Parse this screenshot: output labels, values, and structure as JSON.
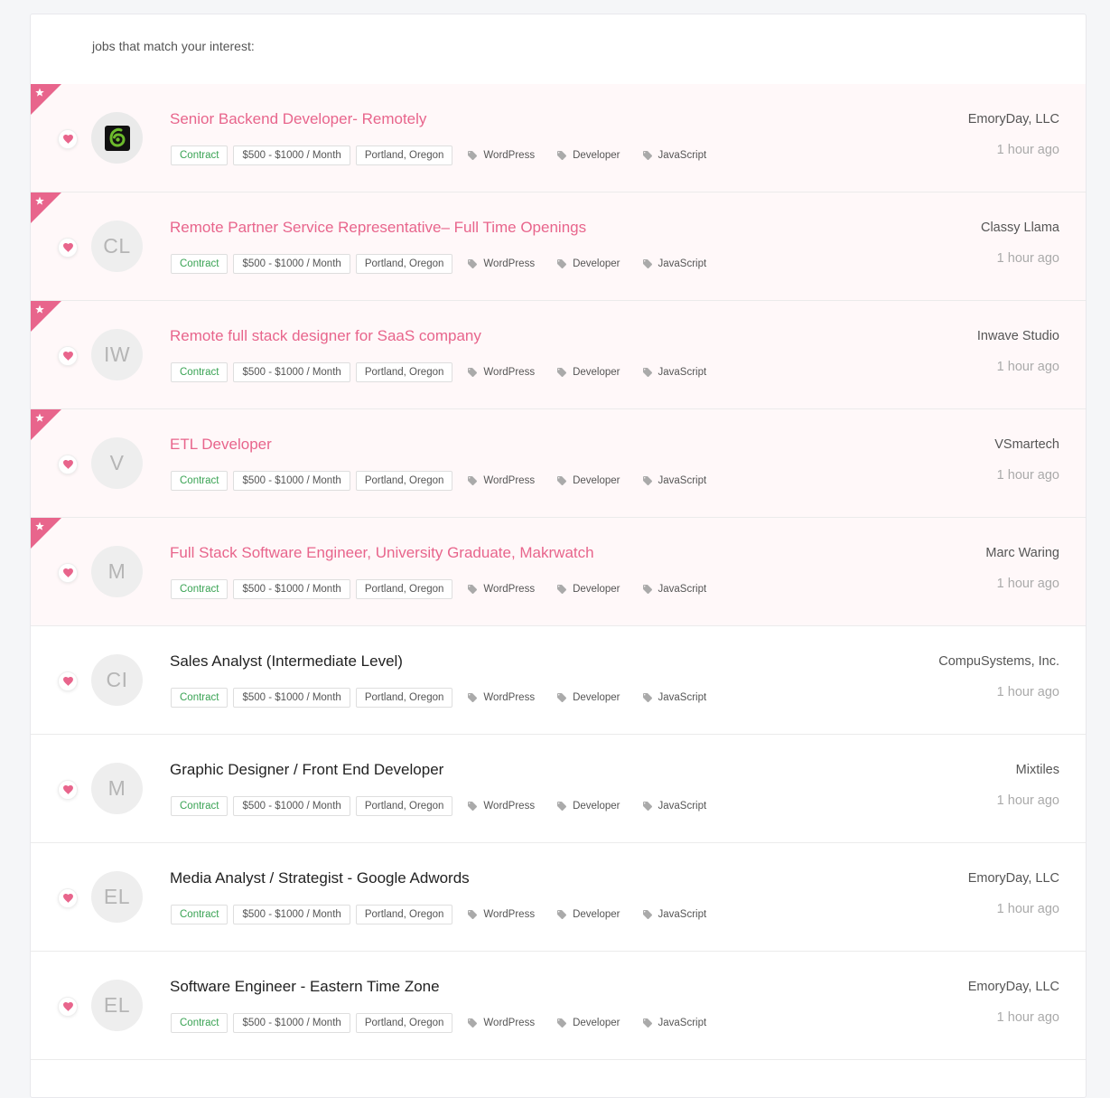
{
  "heading": "jobs that match your interest:",
  "colors": {
    "accent": "#e8658c",
    "contract": "#3aa354",
    "logo_green": "#6dbb2c"
  },
  "jobs": [
    {
      "title": "Senior Backend Developer- Remotely",
      "company": "EmoryDay, LLC",
      "time": "1 hour ago",
      "featured": true,
      "avatar": "",
      "logo": "green-swirl-logo",
      "type": "Contract",
      "salary": "$500 - $1000 / Month",
      "location": "Portland, Oregon",
      "skills": [
        "WordPress",
        "Developer",
        "JavaScript"
      ]
    },
    {
      "title": "Remote Partner Service Representative– Full Time Openings",
      "company": "Classy Llama",
      "time": "1 hour ago",
      "featured": true,
      "avatar": "CL",
      "type": "Contract",
      "salary": "$500 - $1000 / Month",
      "location": "Portland, Oregon",
      "skills": [
        "WordPress",
        "Developer",
        "JavaScript"
      ]
    },
    {
      "title": "Remote full stack designer for SaaS company",
      "company": "Inwave Studio",
      "time": "1 hour ago",
      "featured": true,
      "avatar": "IW",
      "type": "Contract",
      "salary": "$500 - $1000 / Month",
      "location": "Portland, Oregon",
      "skills": [
        "WordPress",
        "Developer",
        "JavaScript"
      ]
    },
    {
      "title": "ETL Developer",
      "company": "VSmartech",
      "time": "1 hour ago",
      "featured": true,
      "avatar": "V",
      "type": "Contract",
      "salary": "$500 - $1000 / Month",
      "location": "Portland, Oregon",
      "skills": [
        "WordPress",
        "Developer",
        "JavaScript"
      ]
    },
    {
      "title": "Full Stack Software Engineer, University Graduate, Makrwatch",
      "company": "Marc Waring",
      "time": "1 hour ago",
      "featured": true,
      "avatar": "M",
      "type": "Contract",
      "salary": "$500 - $1000 / Month",
      "location": "Portland, Oregon",
      "skills": [
        "WordPress",
        "Developer",
        "JavaScript"
      ]
    },
    {
      "title": "Sales Analyst (Intermediate Level)",
      "company": "CompuSystems, Inc.",
      "time": "1 hour ago",
      "featured": false,
      "avatar": "CI",
      "type": "Contract",
      "salary": "$500 - $1000 / Month",
      "location": "Portland, Oregon",
      "skills": [
        "WordPress",
        "Developer",
        "JavaScript"
      ]
    },
    {
      "title": "Graphic Designer / Front End Developer",
      "company": "Mixtiles",
      "time": "1 hour ago",
      "featured": false,
      "avatar": "M",
      "type": "Contract",
      "salary": "$500 - $1000 / Month",
      "location": "Portland, Oregon",
      "skills": [
        "WordPress",
        "Developer",
        "JavaScript"
      ]
    },
    {
      "title": "Media Analyst / Strategist - Google Adwords",
      "company": "EmoryDay, LLC",
      "time": "1 hour ago",
      "featured": false,
      "avatar": "EL",
      "type": "Contract",
      "salary": "$500 - $1000 / Month",
      "location": "Portland, Oregon",
      "skills": [
        "WordPress",
        "Developer",
        "JavaScript"
      ]
    },
    {
      "title": "Software Engineer - Eastern Time Zone",
      "company": "EmoryDay, LLC",
      "time": "1 hour ago",
      "featured": false,
      "avatar": "EL",
      "type": "Contract",
      "salary": "$500 - $1000 / Month",
      "location": "Portland, Oregon",
      "skills": [
        "WordPress",
        "Developer",
        "JavaScript"
      ]
    }
  ]
}
